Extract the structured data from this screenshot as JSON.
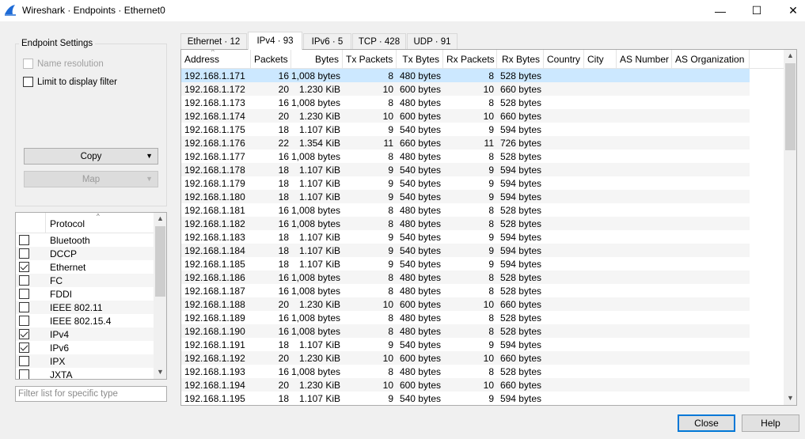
{
  "window": {
    "title": "Wireshark · Endpoints · Ethernet0",
    "minimize": "—",
    "maximize": "☐",
    "close": "✕"
  },
  "settings": {
    "group_title": "Endpoint Settings",
    "name_resolution": "Name resolution",
    "limit_display_filter": "Limit to display filter",
    "copy_label": "Copy",
    "map_label": "Map"
  },
  "protocol_list": {
    "header": "Protocol",
    "items": [
      {
        "name": "Bluetooth",
        "checked": false
      },
      {
        "name": "DCCP",
        "checked": false
      },
      {
        "name": "Ethernet",
        "checked": true
      },
      {
        "name": "FC",
        "checked": false
      },
      {
        "name": "FDDI",
        "checked": false
      },
      {
        "name": "IEEE 802.11",
        "checked": false
      },
      {
        "name": "IEEE 802.15.4",
        "checked": false
      },
      {
        "name": "IPv4",
        "checked": true
      },
      {
        "name": "IPv6",
        "checked": true
      },
      {
        "name": "IPX",
        "checked": false
      },
      {
        "name": "JXTA",
        "checked": false
      }
    ],
    "filter_placeholder": "Filter list for specific type"
  },
  "tabs": [
    {
      "label": "Ethernet · 12",
      "active": false
    },
    {
      "label": "IPv4 · 93",
      "active": true
    },
    {
      "label": "IPv6 · 5",
      "active": false
    },
    {
      "label": "TCP · 428",
      "active": false
    },
    {
      "label": "UDP · 91",
      "active": false
    }
  ],
  "table": {
    "columns": [
      "Address",
      "Packets",
      "Bytes",
      "Tx Packets",
      "Tx Bytes",
      "Rx Packets",
      "Rx Bytes",
      "Country",
      "City",
      "AS Number",
      "AS Organization"
    ],
    "rows": [
      [
        "192.168.1.171",
        "16",
        "1,008 bytes",
        "8",
        "480 bytes",
        "8",
        "528 bytes"
      ],
      [
        "192.168.1.172",
        "20",
        "1.230 KiB",
        "10",
        "600 bytes",
        "10",
        "660 bytes"
      ],
      [
        "192.168.1.173",
        "16",
        "1,008 bytes",
        "8",
        "480 bytes",
        "8",
        "528 bytes"
      ],
      [
        "192.168.1.174",
        "20",
        "1.230 KiB",
        "10",
        "600 bytes",
        "10",
        "660 bytes"
      ],
      [
        "192.168.1.175",
        "18",
        "1.107 KiB",
        "9",
        "540 bytes",
        "9",
        "594 bytes"
      ],
      [
        "192.168.1.176",
        "22",
        "1.354 KiB",
        "11",
        "660 bytes",
        "11",
        "726 bytes"
      ],
      [
        "192.168.1.177",
        "16",
        "1,008 bytes",
        "8",
        "480 bytes",
        "8",
        "528 bytes"
      ],
      [
        "192.168.1.178",
        "18",
        "1.107 KiB",
        "9",
        "540 bytes",
        "9",
        "594 bytes"
      ],
      [
        "192.168.1.179",
        "18",
        "1.107 KiB",
        "9",
        "540 bytes",
        "9",
        "594 bytes"
      ],
      [
        "192.168.1.180",
        "18",
        "1.107 KiB",
        "9",
        "540 bytes",
        "9",
        "594 bytes"
      ],
      [
        "192.168.1.181",
        "16",
        "1,008 bytes",
        "8",
        "480 bytes",
        "8",
        "528 bytes"
      ],
      [
        "192.168.1.182",
        "16",
        "1,008 bytes",
        "8",
        "480 bytes",
        "8",
        "528 bytes"
      ],
      [
        "192.168.1.183",
        "18",
        "1.107 KiB",
        "9",
        "540 bytes",
        "9",
        "594 bytes"
      ],
      [
        "192.168.1.184",
        "18",
        "1.107 KiB",
        "9",
        "540 bytes",
        "9",
        "594 bytes"
      ],
      [
        "192.168.1.185",
        "18",
        "1.107 KiB",
        "9",
        "540 bytes",
        "9",
        "594 bytes"
      ],
      [
        "192.168.1.186",
        "16",
        "1,008 bytes",
        "8",
        "480 bytes",
        "8",
        "528 bytes"
      ],
      [
        "192.168.1.187",
        "16",
        "1,008 bytes",
        "8",
        "480 bytes",
        "8",
        "528 bytes"
      ],
      [
        "192.168.1.188",
        "20",
        "1.230 KiB",
        "10",
        "600 bytes",
        "10",
        "660 bytes"
      ],
      [
        "192.168.1.189",
        "16",
        "1,008 bytes",
        "8",
        "480 bytes",
        "8",
        "528 bytes"
      ],
      [
        "192.168.1.190",
        "16",
        "1,008 bytes",
        "8",
        "480 bytes",
        "8",
        "528 bytes"
      ],
      [
        "192.168.1.191",
        "18",
        "1.107 KiB",
        "9",
        "540 bytes",
        "9",
        "594 bytes"
      ],
      [
        "192.168.1.192",
        "20",
        "1.230 KiB",
        "10",
        "600 bytes",
        "10",
        "660 bytes"
      ],
      [
        "192.168.1.193",
        "16",
        "1,008 bytes",
        "8",
        "480 bytes",
        "8",
        "528 bytes"
      ],
      [
        "192.168.1.194",
        "20",
        "1.230 KiB",
        "10",
        "600 bytes",
        "10",
        "660 bytes"
      ],
      [
        "192.168.1.195",
        "18",
        "1.107 KiB",
        "9",
        "540 bytes",
        "9",
        "594 bytes"
      ]
    ]
  },
  "footer": {
    "close_label": "Close",
    "help_label": "Help"
  },
  "colors": {
    "selected_row": "#cce8ff",
    "brand_fin": "#1e6bd6"
  }
}
